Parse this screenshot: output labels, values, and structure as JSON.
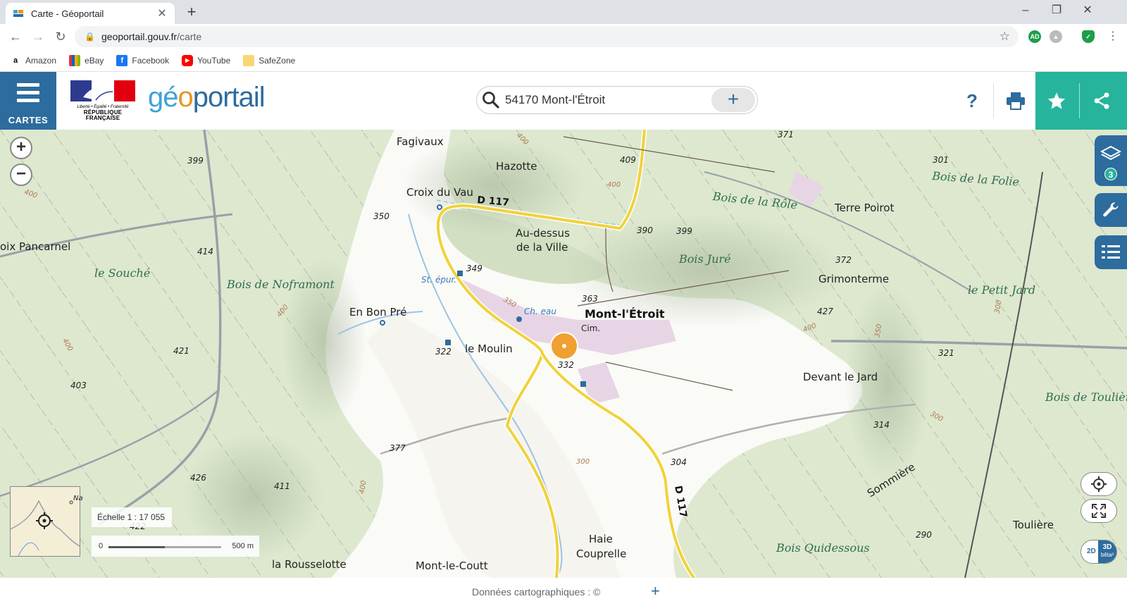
{
  "browser": {
    "tab_title": "Carte - Géoportail",
    "tab_close": "✕",
    "new_tab": "+",
    "url_domain": "geoportail.gouv.fr",
    "url_path": "/carte",
    "win_min": "–",
    "win_max": "❐",
    "win_close": "✕",
    "bookmarks": [
      {
        "label": "Amazon",
        "icon": "amazon-icon"
      },
      {
        "label": "eBay",
        "icon": "ebay-icon"
      },
      {
        "label": "Facebook",
        "icon": "facebook-icon"
      },
      {
        "label": "YouTube",
        "icon": "youtube-icon"
      },
      {
        "label": "SafeZone",
        "icon": "folder-icon"
      }
    ],
    "ext_ad": "AD"
  },
  "header": {
    "cartes_label": "CARTES",
    "rf_motto": "Liberté • Égalité • Fraternité",
    "rf_name": "RÉPUBLIQUE FRANÇAISE",
    "logo_g": "g",
    "logo_e": "é",
    "logo_o": "o",
    "logo_rest": "portail",
    "search_value": "54170 Mont-l'Étroit",
    "search_plus": "+",
    "help": "?"
  },
  "colors": {
    "brand_blue": "#2d6c9e",
    "teal": "#26b49c",
    "forest": "#dde8cf",
    "road": "#f0d23c"
  },
  "map": {
    "places": [
      {
        "t": "Fagivaux"
      },
      {
        "t": "Hazotte"
      },
      {
        "t": "Croix du Vau"
      },
      {
        "t": "Au-dessus"
      },
      {
        "t": "de la Ville"
      },
      {
        "t": "oix Pancarnel"
      },
      {
        "t": "le Souché"
      },
      {
        "t": "En Bon Pré"
      },
      {
        "t": "le Moulin"
      },
      {
        "t": "Terre Poirot"
      },
      {
        "t": "Grimonterme"
      },
      {
        "t": "Devant le Jard"
      },
      {
        "t": "Sommière"
      },
      {
        "t": "Toulière"
      },
      {
        "t": "Haie"
      },
      {
        "t": "Couprelle"
      },
      {
        "t": "la Rousselotte"
      },
      {
        "t": "Mont-le-Coutt"
      },
      {
        "t": "Cim."
      }
    ],
    "woods": [
      {
        "t": "Bois de Noframont"
      },
      {
        "t": "Bois de la Rôle"
      },
      {
        "t": "Bois Juré"
      },
      {
        "t": "Bois de la Folie"
      },
      {
        "t": "le Petit Jard"
      },
      {
        "t": "Bois de Toulière"
      },
      {
        "t": "Bois Quidessous"
      }
    ],
    "town": "Mont-l'Étroit",
    "roads": [
      "D 117",
      "D 117"
    ],
    "water": [
      "St. épur.",
      "Ch. eau"
    ],
    "altitudes": [
      "399",
      "350",
      "414",
      "349",
      "421",
      "403",
      "426",
      "411",
      "422",
      "377",
      "322",
      "332",
      "363",
      "409",
      "390",
      "399",
      "371",
      "301",
      "372",
      "427",
      "321",
      "314",
      "304",
      "290",
      "Na"
    ],
    "contours": [
      "400",
      "400",
      "400",
      "400",
      "350",
      "400",
      "400",
      "400",
      "350",
      "300",
      "300",
      "300"
    ],
    "zoom_in": "+",
    "zoom_out": "−",
    "layers_count": "3",
    "scale_text": "Échelle 1 : 17 055",
    "scale_zero": "0",
    "scale_max": "500 m",
    "mode_2d": "2D",
    "mode_3d": "3D",
    "mode_beta": "bêta²"
  },
  "footer": {
    "text": "Données cartographiques : ©",
    "plus": "+"
  }
}
